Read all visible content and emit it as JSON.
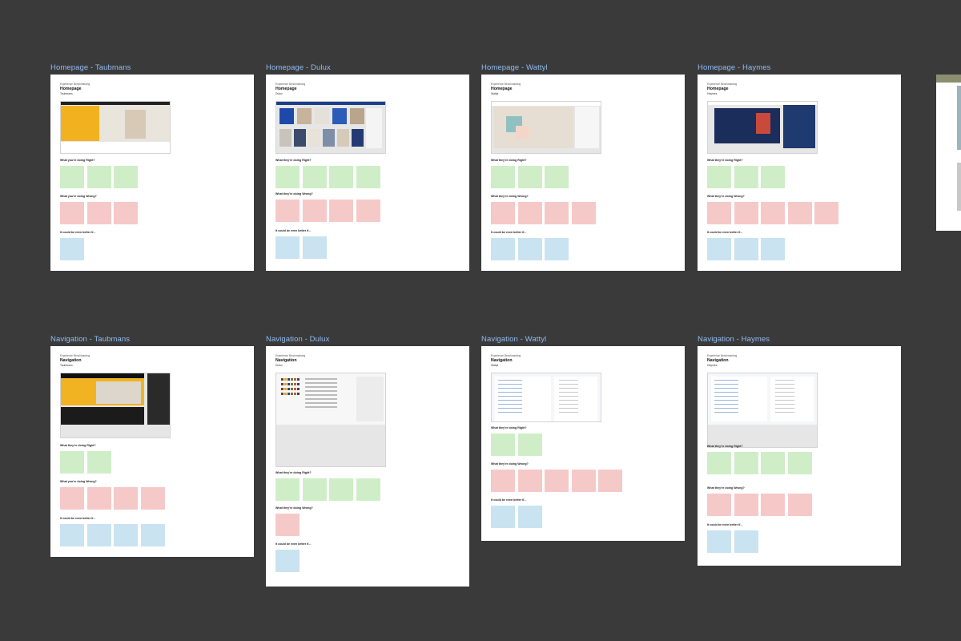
{
  "canvas": {
    "background": "#3a3a3a",
    "label_color": "#8fbcf0"
  },
  "frames": [
    {
      "label": "Homepage - Taubmans",
      "meta_top": "Experience Benchmarking",
      "title": "Homepage",
      "brand": "Taubmans",
      "shot_theme": "yellow",
      "sections": [
        {
          "heading": "What you're doing Right?",
          "color": "green",
          "notes": [
            "",
            "",
            ""
          ]
        },
        {
          "heading": "What you're doing Wrong?",
          "color": "red",
          "notes": [
            "",
            "",
            ""
          ]
        },
        {
          "heading": "It could be even better if...",
          "color": "blue",
          "notes": [
            ""
          ]
        }
      ]
    },
    {
      "label": "Homepage - Dulux",
      "meta_top": "Experience Benchmarking",
      "title": "Homepage",
      "brand": "Dulux",
      "shot_theme": "grid",
      "sections": [
        {
          "heading": "What they're doing Right?",
          "color": "green",
          "notes": [
            "",
            "",
            "",
            ""
          ]
        },
        {
          "heading": "What they're doing Wrong?",
          "color": "red",
          "notes": [
            "",
            "",
            "",
            ""
          ]
        },
        {
          "heading": "It could be even better if...",
          "color": "blue",
          "notes": [
            "",
            ""
          ]
        }
      ]
    },
    {
      "label": "Homepage - Wattyl",
      "meta_top": "Experience Benchmarking",
      "title": "Homepage",
      "brand": "Wattyl",
      "shot_theme": "pastel",
      "sections": [
        {
          "heading": "What they're doing Right?",
          "color": "green",
          "notes": [
            "",
            "",
            ""
          ]
        },
        {
          "heading": "What they're doing Wrong?",
          "color": "red",
          "notes": [
            "",
            "",
            "",
            ""
          ]
        },
        {
          "heading": "It could be even better if...",
          "color": "blue",
          "notes": [
            "",
            "",
            ""
          ]
        }
      ]
    },
    {
      "label": "Homepage - Haymes",
      "meta_top": "Experience Benchmarking",
      "title": "Homepage",
      "brand": "Haymes",
      "shot_theme": "navy",
      "sections": [
        {
          "heading": "What they're doing Right?",
          "color": "green",
          "notes": [
            "",
            "",
            ""
          ]
        },
        {
          "heading": "What they're doing Wrong?",
          "color": "red",
          "notes": [
            "",
            "",
            "",
            "",
            ""
          ]
        },
        {
          "heading": "It could be even better if...",
          "color": "blue",
          "notes": [
            "",
            "",
            ""
          ]
        }
      ]
    },
    {
      "label": "Navigation - Taubmans",
      "meta_top": "Experience Benchmarking",
      "title": "Navigation",
      "brand": "Taubmans",
      "shot_theme": "dark",
      "sections": [
        {
          "heading": "What they're doing Right?",
          "color": "green",
          "notes": [
            "",
            ""
          ]
        },
        {
          "heading": "What you're doing Wrong?",
          "color": "red",
          "notes": [
            "",
            "",
            "",
            ""
          ]
        },
        {
          "heading": "It could be even better if...",
          "color": "blue",
          "notes": [
            "",
            "",
            "",
            ""
          ]
        }
      ]
    },
    {
      "label": "Navigation - Dulux",
      "meta_top": "Experience Benchmarking",
      "title": "Navigation",
      "brand": "Dulux",
      "shot_theme": "menu",
      "sections": [
        {
          "heading": "What they're doing Right?",
          "color": "green",
          "notes": [
            "",
            "",
            "",
            ""
          ]
        },
        {
          "heading": "What they're doing Wrong?",
          "color": "red",
          "notes": [
            ""
          ]
        },
        {
          "heading": "It could be even better if...",
          "color": "blue",
          "notes": [
            ""
          ]
        }
      ]
    },
    {
      "label": "Navigation - Wattyl",
      "meta_top": "Experience Benchmarking",
      "title": "Navigation",
      "brand": "Wattyl",
      "shot_theme": "light",
      "sections": [
        {
          "heading": "What they're doing Right?",
          "color": "green",
          "notes": [
            "",
            ""
          ]
        },
        {
          "heading": "What they're doing Wrong?",
          "color": "red",
          "notes": [
            "",
            "",
            "",
            "",
            ""
          ]
        },
        {
          "heading": "It could be even better if...",
          "color": "blue",
          "notes": [
            "",
            ""
          ]
        }
      ]
    },
    {
      "label": "Navigation - Haymes",
      "meta_top": "Experience Benchmarking",
      "title": "Navigation",
      "brand": "Haymes",
      "shot_theme": "light",
      "sections": [
        {
          "heading": "What they're doing Right?",
          "color": "green",
          "notes": [
            "",
            "",
            "",
            ""
          ]
        },
        {
          "heading": "What they're doing Wrong?",
          "color": "red",
          "notes": [
            "",
            "",
            "",
            ""
          ]
        },
        {
          "heading": "It could be even better if...",
          "color": "blue",
          "notes": [
            "",
            ""
          ]
        }
      ]
    }
  ]
}
